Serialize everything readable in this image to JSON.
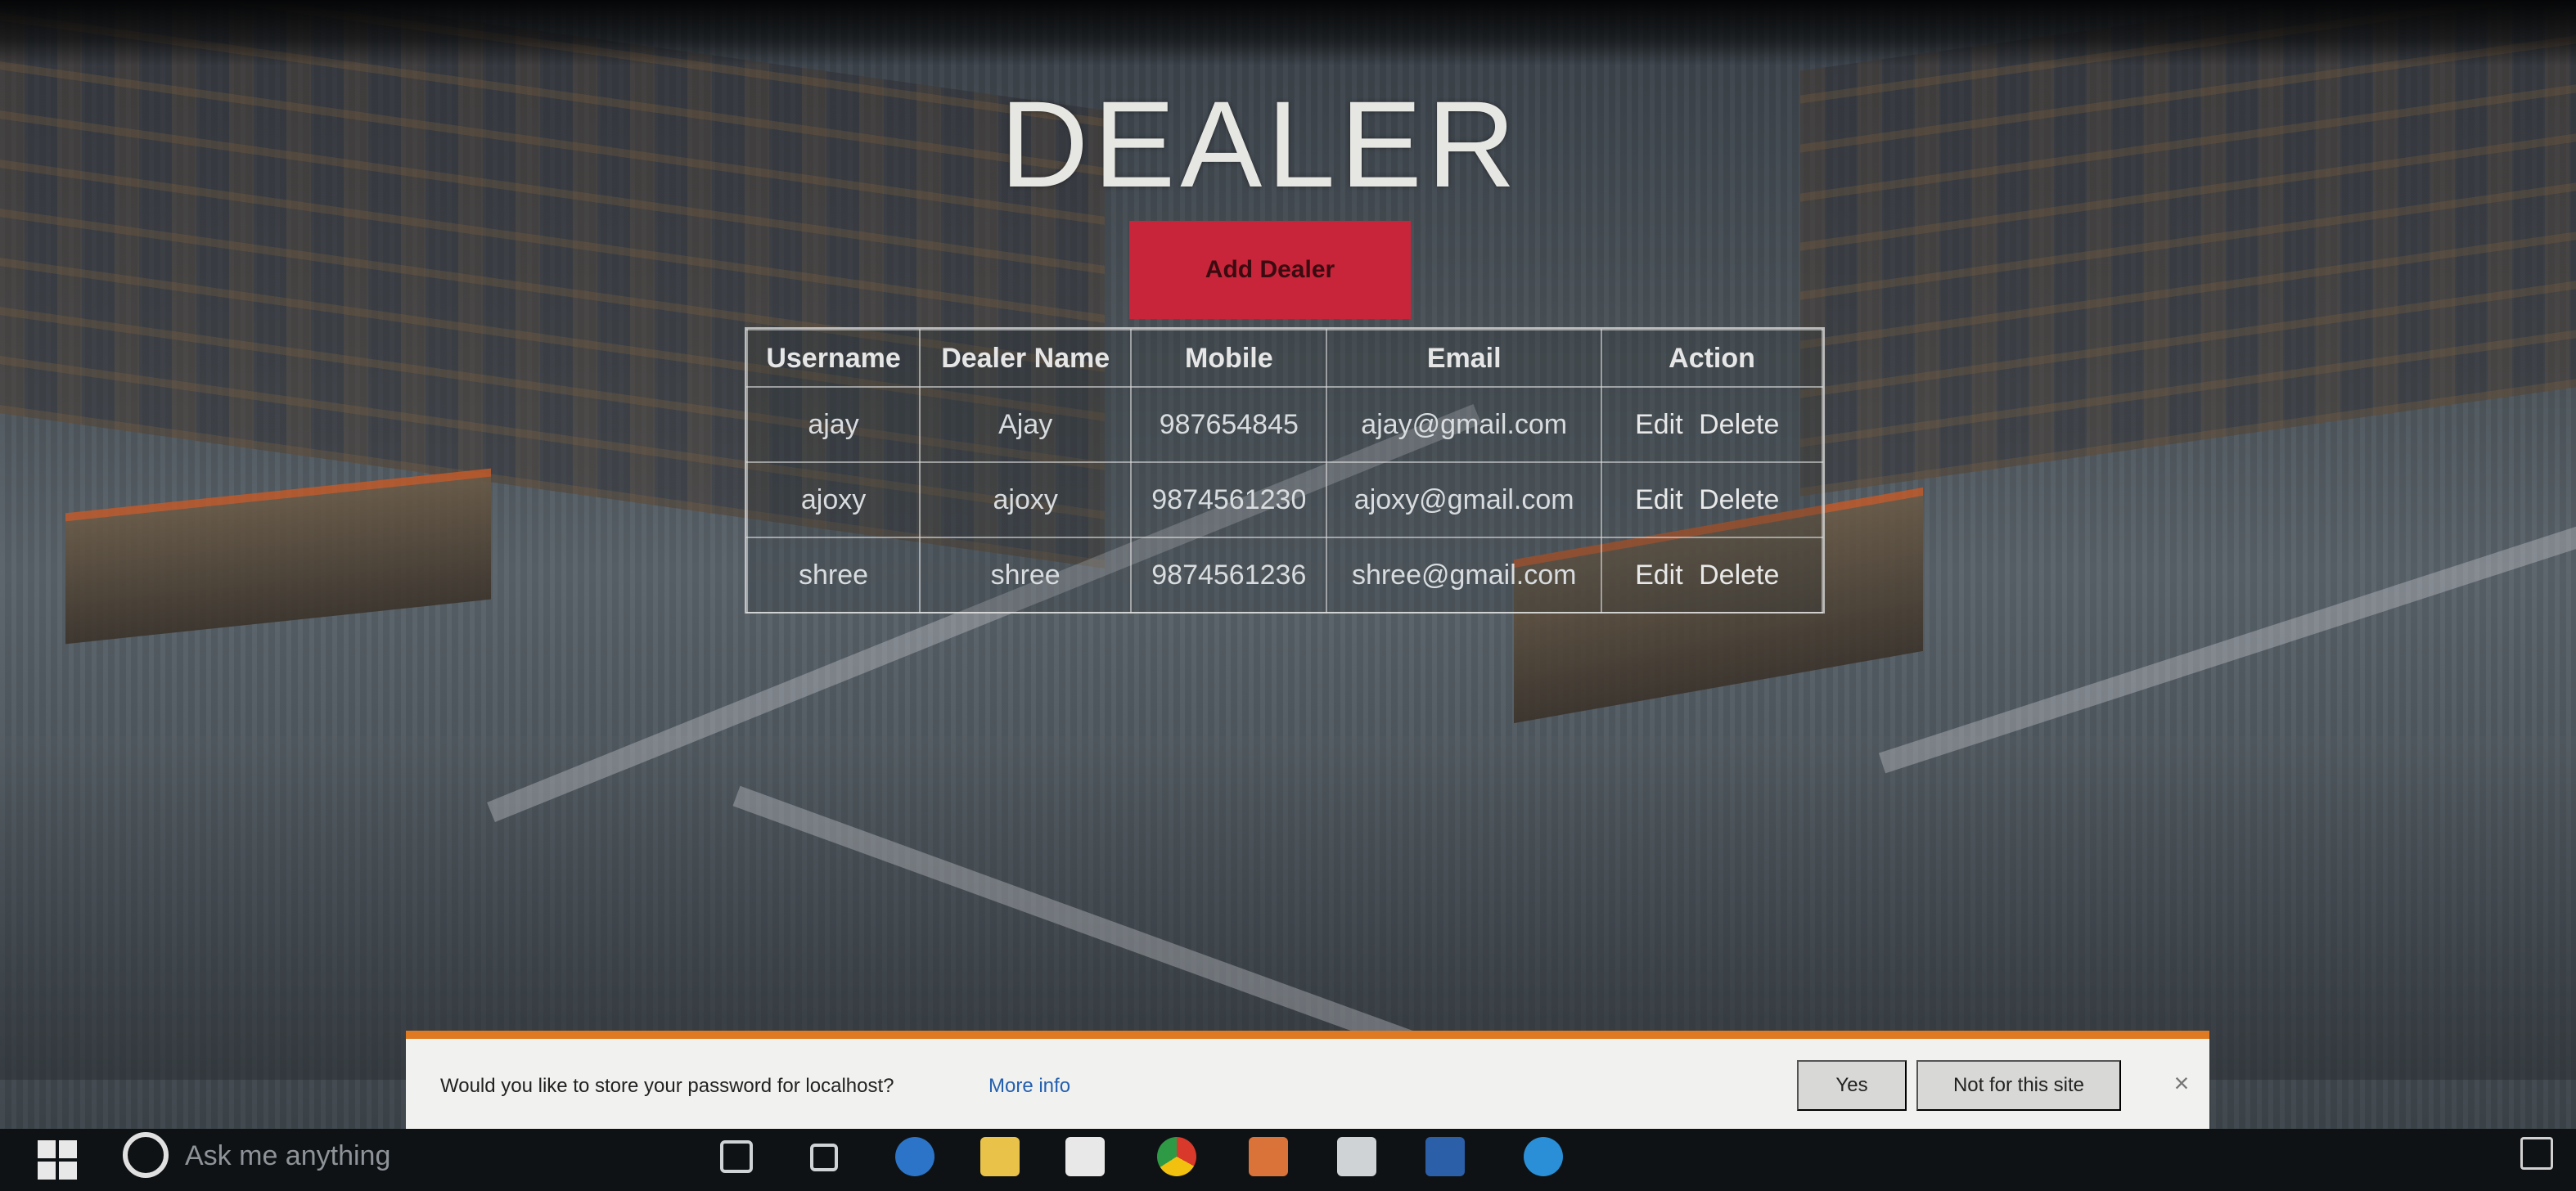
{
  "page": {
    "title": "DEALER",
    "add_button_label": "Add Dealer"
  },
  "table": {
    "headers": [
      "Username",
      "Dealer Name",
      "Mobile",
      "Email",
      "Action"
    ],
    "rows": [
      {
        "username": "ajay",
        "dealer_name": "Ajay",
        "mobile": "987654845",
        "email": "ajay@gmail.com"
      },
      {
        "username": "ajoxy",
        "dealer_name": "ajoxy",
        "mobile": "9874561230",
        "email": "ajoxy@gmail.com"
      },
      {
        "username": "shree",
        "dealer_name": "shree",
        "mobile": "9874561236",
        "email": "shree@gmail.com"
      }
    ],
    "action_edit_label": "Edit",
    "action_delete_label": "Delete"
  },
  "password_bar": {
    "message": "Would you like to store your password for localhost?",
    "more_info": "More info",
    "yes_label": "Yes",
    "not_for_site_label": "Not for this site",
    "close_glyph": "×"
  },
  "taskbar": {
    "search_placeholder": "Ask me anything",
    "icons": [
      "task-view-icon",
      "edge-icon",
      "file-explorer-icon",
      "store-icon",
      "chrome-icon",
      "app-icon",
      "box-icon",
      "word-icon",
      "internet-explorer-icon"
    ]
  },
  "colors": {
    "accent_button": "#c8243a",
    "password_bar_border": "#e07a22",
    "link_blue": "#2460b0"
  }
}
